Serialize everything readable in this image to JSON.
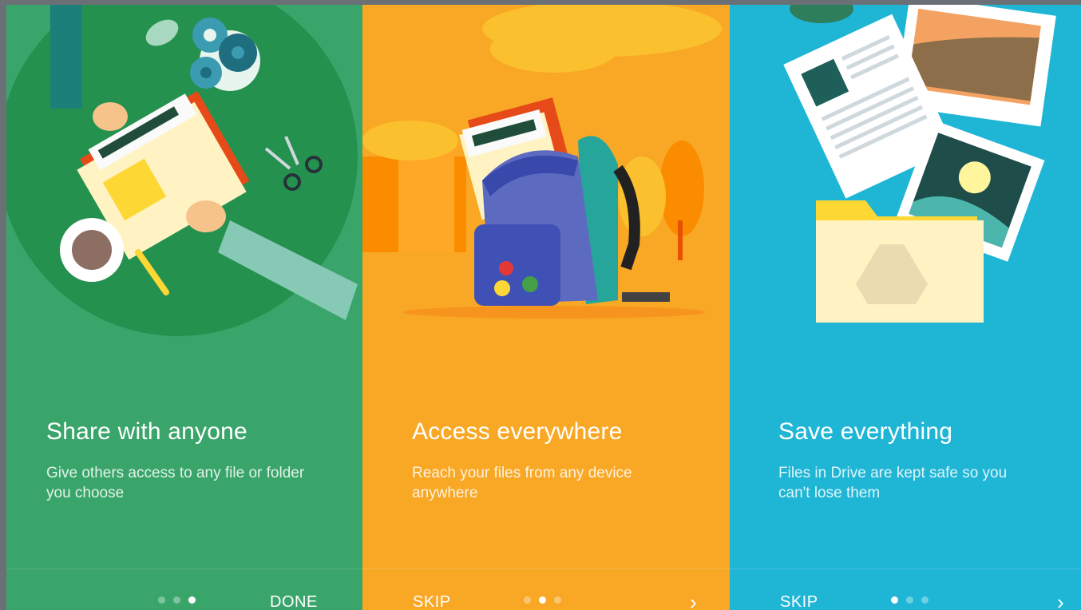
{
  "panels": [
    {
      "title": "Share with anyone",
      "description": "Give others access to any file or folder you choose",
      "left_action": "",
      "right_action": "DONE",
      "active_dot": 2,
      "bg": "#3aa56a",
      "illustration": "share-illustration"
    },
    {
      "title": "Access everywhere",
      "description": "Reach your files from any device anywhere",
      "left_action": "SKIP",
      "right_action_icon": "chevron-right-icon",
      "active_dot": 1,
      "bg": "#f9a825",
      "illustration": "backpack-illustration"
    },
    {
      "title": "Save everything",
      "description": "Files in Drive are kept safe so you can't lose them",
      "left_action": "SKIP",
      "right_action_icon": "chevron-right-icon",
      "active_dot": 0,
      "bg": "#1fb6d6",
      "illustration": "drive-folder-illustration"
    }
  ],
  "pager": {
    "dot_count": 3
  }
}
